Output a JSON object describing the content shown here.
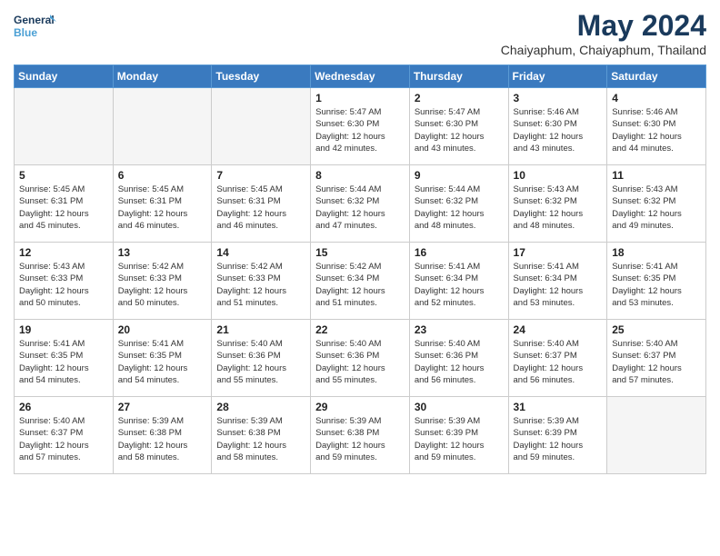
{
  "logo": {
    "line1": "General",
    "line2": "Blue"
  },
  "title": {
    "month_year": "May 2024",
    "location": "Chaiyaphum, Chaiyaphum, Thailand"
  },
  "days_of_week": [
    "Sunday",
    "Monday",
    "Tuesday",
    "Wednesday",
    "Thursday",
    "Friday",
    "Saturday"
  ],
  "weeks": [
    [
      {
        "day": "",
        "info": "",
        "empty": true
      },
      {
        "day": "",
        "info": "",
        "empty": true
      },
      {
        "day": "",
        "info": "",
        "empty": true
      },
      {
        "day": "1",
        "info": "Sunrise: 5:47 AM\nSunset: 6:30 PM\nDaylight: 12 hours\nand 42 minutes."
      },
      {
        "day": "2",
        "info": "Sunrise: 5:47 AM\nSunset: 6:30 PM\nDaylight: 12 hours\nand 43 minutes."
      },
      {
        "day": "3",
        "info": "Sunrise: 5:46 AM\nSunset: 6:30 PM\nDaylight: 12 hours\nand 43 minutes."
      },
      {
        "day": "4",
        "info": "Sunrise: 5:46 AM\nSunset: 6:30 PM\nDaylight: 12 hours\nand 44 minutes."
      }
    ],
    [
      {
        "day": "5",
        "info": "Sunrise: 5:45 AM\nSunset: 6:31 PM\nDaylight: 12 hours\nand 45 minutes."
      },
      {
        "day": "6",
        "info": "Sunrise: 5:45 AM\nSunset: 6:31 PM\nDaylight: 12 hours\nand 46 minutes."
      },
      {
        "day": "7",
        "info": "Sunrise: 5:45 AM\nSunset: 6:31 PM\nDaylight: 12 hours\nand 46 minutes."
      },
      {
        "day": "8",
        "info": "Sunrise: 5:44 AM\nSunset: 6:32 PM\nDaylight: 12 hours\nand 47 minutes."
      },
      {
        "day": "9",
        "info": "Sunrise: 5:44 AM\nSunset: 6:32 PM\nDaylight: 12 hours\nand 48 minutes."
      },
      {
        "day": "10",
        "info": "Sunrise: 5:43 AM\nSunset: 6:32 PM\nDaylight: 12 hours\nand 48 minutes."
      },
      {
        "day": "11",
        "info": "Sunrise: 5:43 AM\nSunset: 6:32 PM\nDaylight: 12 hours\nand 49 minutes."
      }
    ],
    [
      {
        "day": "12",
        "info": "Sunrise: 5:43 AM\nSunset: 6:33 PM\nDaylight: 12 hours\nand 50 minutes."
      },
      {
        "day": "13",
        "info": "Sunrise: 5:42 AM\nSunset: 6:33 PM\nDaylight: 12 hours\nand 50 minutes."
      },
      {
        "day": "14",
        "info": "Sunrise: 5:42 AM\nSunset: 6:33 PM\nDaylight: 12 hours\nand 51 minutes."
      },
      {
        "day": "15",
        "info": "Sunrise: 5:42 AM\nSunset: 6:34 PM\nDaylight: 12 hours\nand 51 minutes."
      },
      {
        "day": "16",
        "info": "Sunrise: 5:41 AM\nSunset: 6:34 PM\nDaylight: 12 hours\nand 52 minutes."
      },
      {
        "day": "17",
        "info": "Sunrise: 5:41 AM\nSunset: 6:34 PM\nDaylight: 12 hours\nand 53 minutes."
      },
      {
        "day": "18",
        "info": "Sunrise: 5:41 AM\nSunset: 6:35 PM\nDaylight: 12 hours\nand 53 minutes."
      }
    ],
    [
      {
        "day": "19",
        "info": "Sunrise: 5:41 AM\nSunset: 6:35 PM\nDaylight: 12 hours\nand 54 minutes."
      },
      {
        "day": "20",
        "info": "Sunrise: 5:41 AM\nSunset: 6:35 PM\nDaylight: 12 hours\nand 54 minutes."
      },
      {
        "day": "21",
        "info": "Sunrise: 5:40 AM\nSunset: 6:36 PM\nDaylight: 12 hours\nand 55 minutes."
      },
      {
        "day": "22",
        "info": "Sunrise: 5:40 AM\nSunset: 6:36 PM\nDaylight: 12 hours\nand 55 minutes."
      },
      {
        "day": "23",
        "info": "Sunrise: 5:40 AM\nSunset: 6:36 PM\nDaylight: 12 hours\nand 56 minutes."
      },
      {
        "day": "24",
        "info": "Sunrise: 5:40 AM\nSunset: 6:37 PM\nDaylight: 12 hours\nand 56 minutes."
      },
      {
        "day": "25",
        "info": "Sunrise: 5:40 AM\nSunset: 6:37 PM\nDaylight: 12 hours\nand 57 minutes."
      }
    ],
    [
      {
        "day": "26",
        "info": "Sunrise: 5:40 AM\nSunset: 6:37 PM\nDaylight: 12 hours\nand 57 minutes."
      },
      {
        "day": "27",
        "info": "Sunrise: 5:39 AM\nSunset: 6:38 PM\nDaylight: 12 hours\nand 58 minutes."
      },
      {
        "day": "28",
        "info": "Sunrise: 5:39 AM\nSunset: 6:38 PM\nDaylight: 12 hours\nand 58 minutes."
      },
      {
        "day": "29",
        "info": "Sunrise: 5:39 AM\nSunset: 6:38 PM\nDaylight: 12 hours\nand 59 minutes."
      },
      {
        "day": "30",
        "info": "Sunrise: 5:39 AM\nSunset: 6:39 PM\nDaylight: 12 hours\nand 59 minutes."
      },
      {
        "day": "31",
        "info": "Sunrise: 5:39 AM\nSunset: 6:39 PM\nDaylight: 12 hours\nand 59 minutes."
      },
      {
        "day": "",
        "info": "",
        "empty": true
      }
    ]
  ]
}
